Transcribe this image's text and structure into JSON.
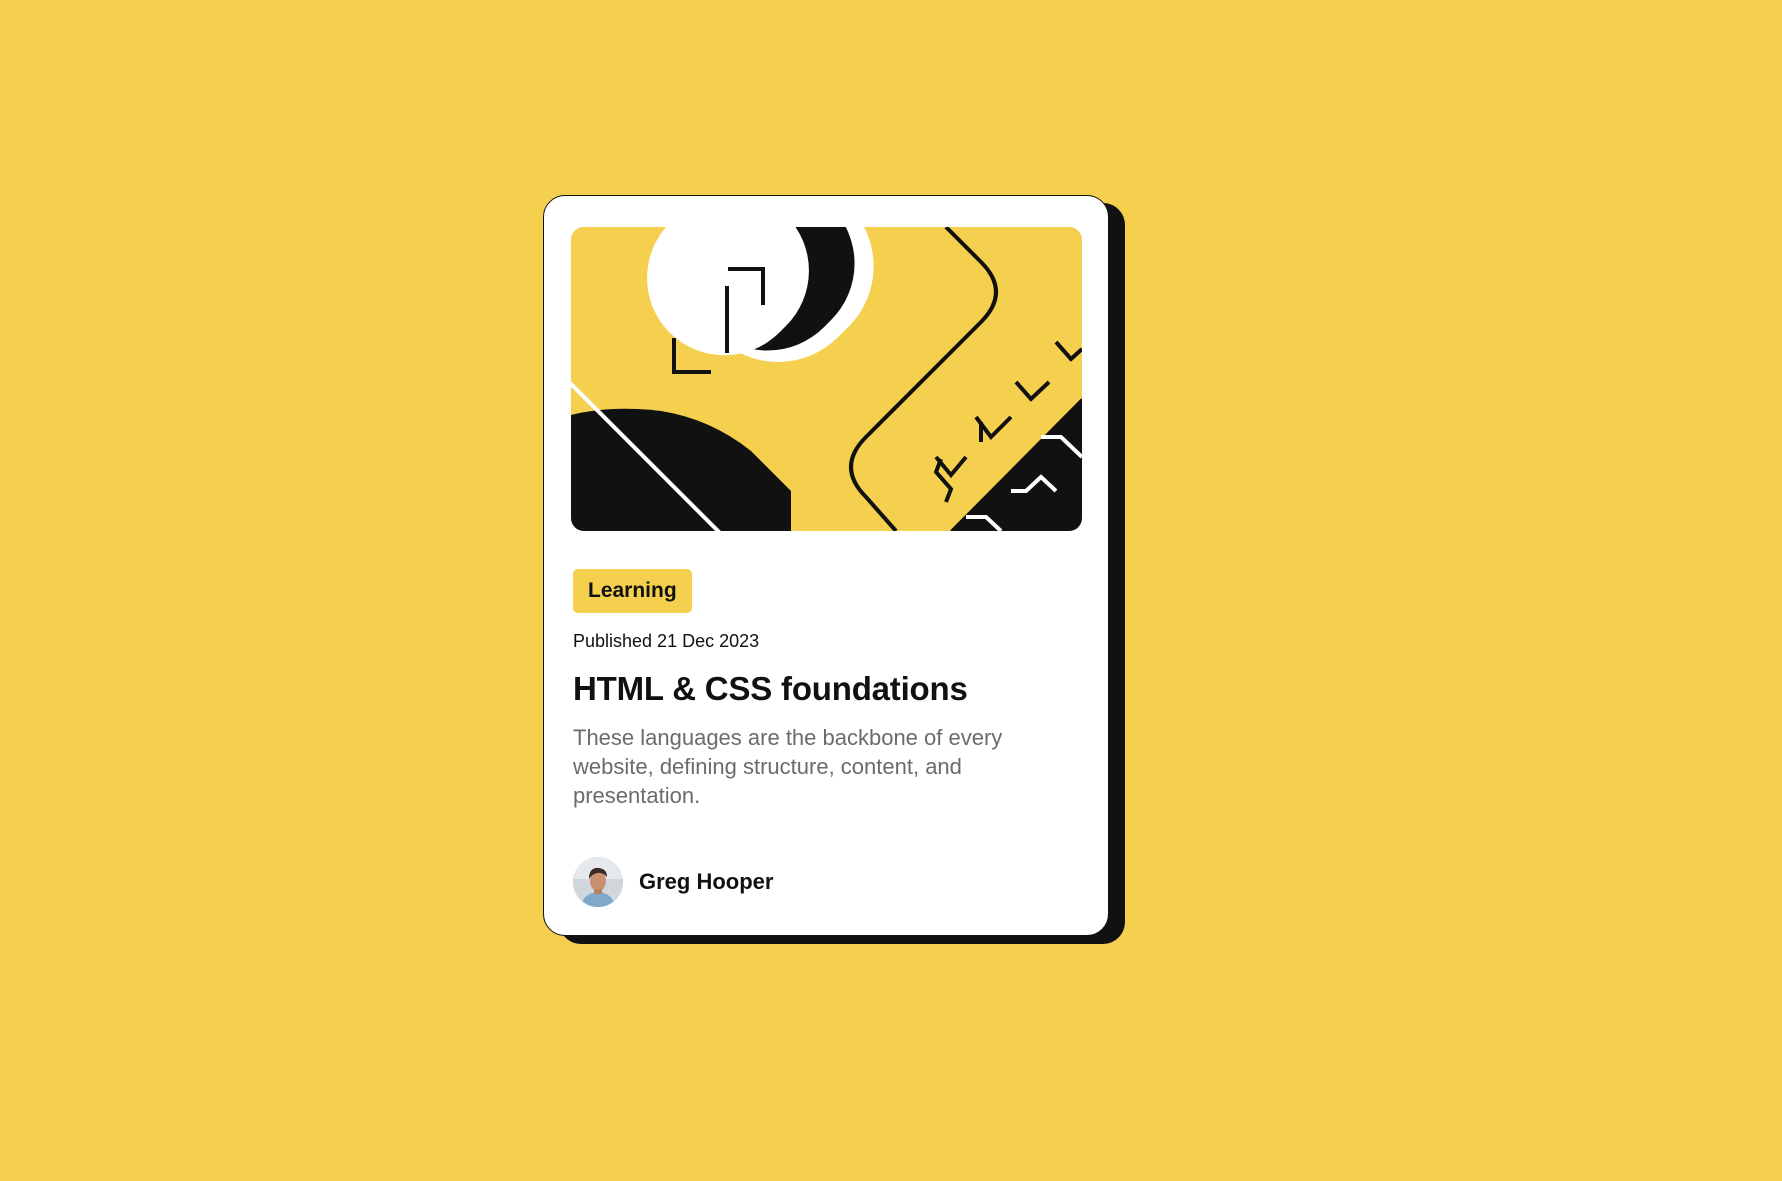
{
  "card": {
    "category": "Learning",
    "published": "Published 21 Dec 2023",
    "title": "HTML & CSS foundations",
    "description": "These languages are the backbone of every website, defining structure, content, and presentation.",
    "author": {
      "name": "Greg Hooper",
      "avatar_icon": "avatar-photo"
    },
    "illustration_icon": "abstract-yellow-black-illustration"
  },
  "colors": {
    "background": "#F4D04E",
    "card": "#FFFFFF",
    "ink": "#111111",
    "muted_text": "#6B6B6B"
  }
}
